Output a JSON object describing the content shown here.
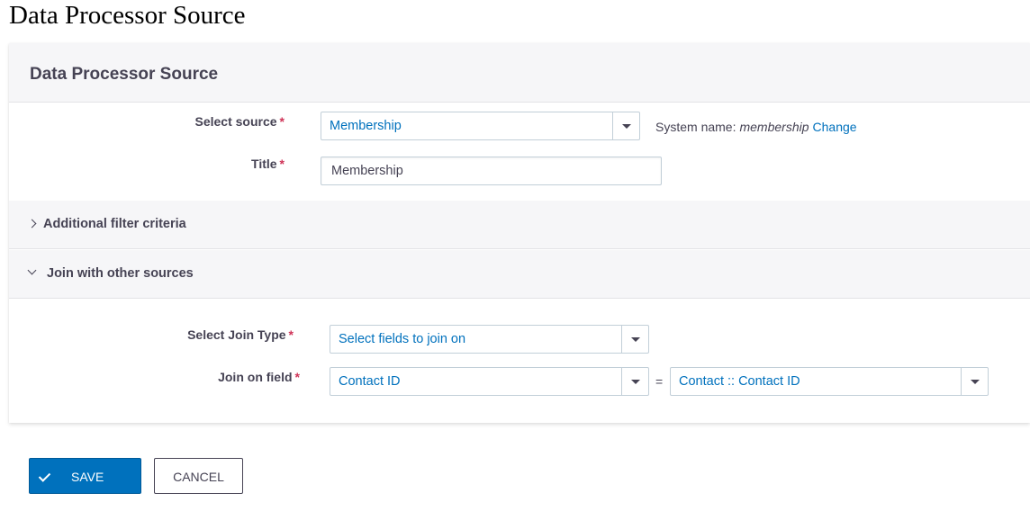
{
  "page": {
    "title": "Data Processor Source"
  },
  "panel": {
    "title": "Data Processor Source"
  },
  "form": {
    "select_source": {
      "label": "Select source",
      "value": "Membership"
    },
    "title": {
      "label": "Title",
      "value": "Membership"
    },
    "system_name": {
      "label": "System name:",
      "value": "membership",
      "change_link": "Change"
    },
    "required_marker": "*"
  },
  "accordions": {
    "filter": {
      "title": "Additional filter criteria",
      "expanded": false
    },
    "join": {
      "title": "Join with other sources",
      "expanded": true
    }
  },
  "join": {
    "join_type": {
      "label": "Select Join Type",
      "value": "Select fields to join on"
    },
    "join_field": {
      "label": "Join on field",
      "left_value": "Contact ID",
      "equals": "=",
      "right_value": "Contact :: Contact ID"
    }
  },
  "buttons": {
    "save": "Save",
    "cancel": "Cancel"
  },
  "colors": {
    "accent": "#0071bd",
    "required": "#cf3458",
    "text": "#464354"
  }
}
